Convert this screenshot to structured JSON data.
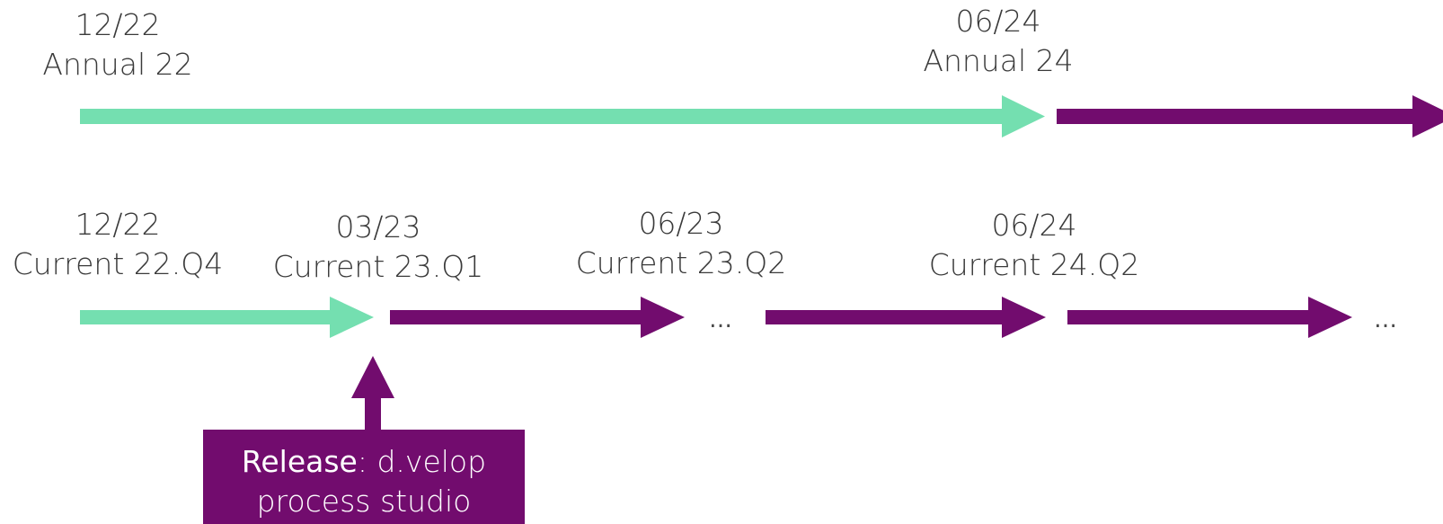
{
  "colors": {
    "green": "#74dfb0",
    "purple": "#720c6e",
    "text": "#3a3a3a"
  },
  "annual": {
    "start": {
      "date": "12/22",
      "name": "Annual 22"
    },
    "next": {
      "date": "06/24",
      "name": "Annual 24"
    }
  },
  "current": [
    {
      "date": "12/22",
      "name": "Current 22.Q4"
    },
    {
      "date": "03/23",
      "name": "Current 23.Q1"
    },
    {
      "date": "06/23",
      "name": "Current 23.Q2"
    },
    {
      "date": "06/24",
      "name": "Current 24.Q2"
    }
  ],
  "ellipsis": "…",
  "release": {
    "prefix": "Release",
    "colon_text": ": d.velop",
    "line2": "process studio"
  }
}
